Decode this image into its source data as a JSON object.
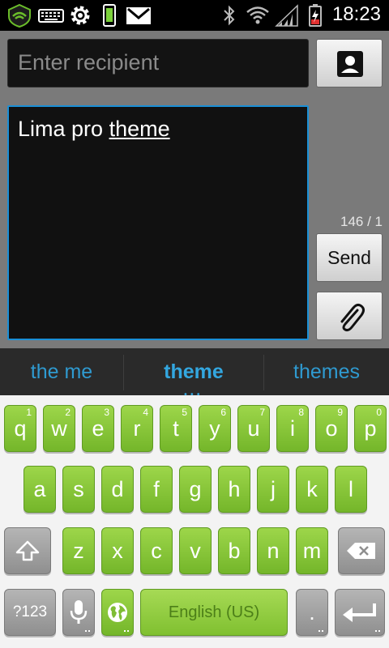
{
  "status_bar": {
    "icons": [
      "shield-icon",
      "keyboard-icon",
      "settings-gear-icon",
      "phone-battery-icon",
      "gmail-icon",
      "bluetooth-icon",
      "wifi-icon",
      "signal-icon",
      "battery-icon"
    ],
    "time": "18:23"
  },
  "compose": {
    "recipient_placeholder": "Enter recipient",
    "message_text_plain": "Lima pro ",
    "message_text_underlined": "theme",
    "counter": "146 / 1",
    "send_label": "Send",
    "colors": {
      "focus_border": "#1a8fd6",
      "field_bg": "#111111"
    }
  },
  "suggestions": [
    {
      "label": "the me",
      "selected": false
    },
    {
      "label": "theme",
      "selected": true
    },
    {
      "label": "themes",
      "selected": false
    }
  ],
  "keyboard": {
    "row1": [
      {
        "label": "q",
        "hint": "1"
      },
      {
        "label": "w",
        "hint": "2"
      },
      {
        "label": "e",
        "hint": "3"
      },
      {
        "label": "r",
        "hint": "4"
      },
      {
        "label": "t",
        "hint": "5"
      },
      {
        "label": "y",
        "hint": "6"
      },
      {
        "label": "u",
        "hint": "7"
      },
      {
        "label": "i",
        "hint": "8"
      },
      {
        "label": "o",
        "hint": "9"
      },
      {
        "label": "p",
        "hint": "0"
      }
    ],
    "row2": [
      "a",
      "s",
      "d",
      "f",
      "g",
      "h",
      "j",
      "k",
      "l"
    ],
    "row3": [
      "z",
      "x",
      "c",
      "v",
      "b",
      "n",
      "m"
    ],
    "symbols_label": "?123",
    "space_label": "English (US)",
    "period_label": ".",
    "colors": {
      "key_green": "#8cca3c",
      "key_gray": "#a3a3a3",
      "background": "#f3f3f3"
    }
  }
}
